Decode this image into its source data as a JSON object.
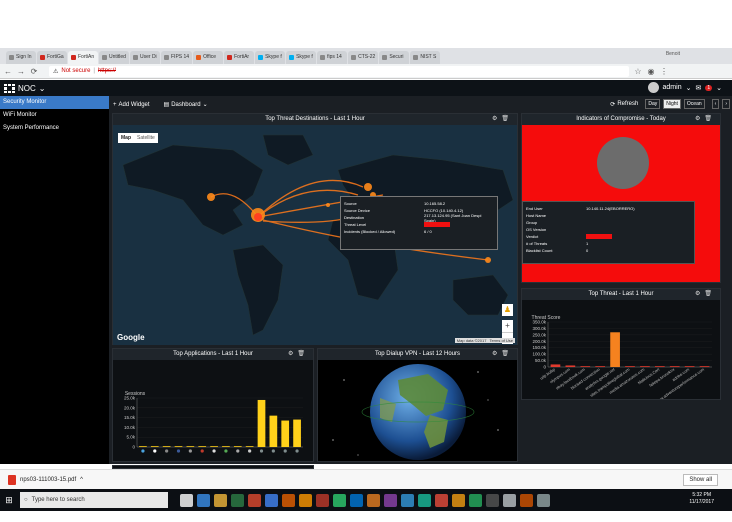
{
  "browser": {
    "tabs": [
      {
        "label": "Sign In",
        "icon": "page-icon"
      },
      {
        "label": "FortiGa",
        "icon": "fortinet-icon"
      },
      {
        "label": "FortiAn",
        "icon": "fortinet-icon",
        "active": true
      },
      {
        "label": "Untitled",
        "icon": "page-icon"
      },
      {
        "label": "User Di",
        "icon": "page-icon"
      },
      {
        "label": "FIPS 14",
        "icon": "page-icon"
      },
      {
        "label": "Office",
        "icon": "office-icon"
      },
      {
        "label": "FortiAr",
        "icon": "fortinet-icon"
      },
      {
        "label": "Skype f",
        "icon": "skype-icon"
      },
      {
        "label": "Skype f",
        "icon": "skype-icon"
      },
      {
        "label": "fips 14",
        "icon": "google-icon"
      },
      {
        "label": "CTS-22",
        "icon": "page-icon"
      },
      {
        "label": "Securi",
        "icon": "page-icon"
      },
      {
        "label": "NIST S",
        "icon": "page-icon"
      }
    ],
    "profile_name": "Benoit",
    "address": {
      "security": "Not secure",
      "url": "https://"
    }
  },
  "app": {
    "name": "NOC",
    "user": "admin",
    "notification_count": "1"
  },
  "sidebar": {
    "items": [
      {
        "label": "Security Monitor",
        "active": true
      },
      {
        "label": "WiFi Monitor"
      },
      {
        "label": "System Performance"
      }
    ]
  },
  "toolbar": {
    "add_widget": "Add Widget",
    "dashboard": "Dashboard",
    "refresh": "Refresh",
    "modes": [
      "Day",
      "Night",
      "Ocean"
    ],
    "selected_mode": "Night"
  },
  "panels": {
    "threat_map": {
      "title": "Top Threat Destinations - Last 1 Hour",
      "map_tabs": [
        "Map",
        "Satellite"
      ],
      "google": "Google",
      "map_data": "Map data ©2017",
      "terms": "Terms of Use",
      "tooltip": {
        "rows": [
          {
            "k": "Source",
            "v": "10.165.58.2"
          },
          {
            "k": "Source Device",
            "v": "HCCFO (10.140.4.12)"
          },
          {
            "k": "Destination",
            "v": "217.13.124.95 (Sant Joan Despi Spain)"
          },
          {
            "k": "Threat Level",
            "v": ""
          },
          {
            "k": "Incidents (Blocked / Allowed)",
            "v": "6 / 0"
          }
        ]
      }
    },
    "ioc": {
      "title": "Indicators of Compromise - Today",
      "rows": [
        {
          "k": "End User",
          "v": "10.140.11.24(EBORRERO)"
        },
        {
          "k": "Host Name",
          "v": ""
        },
        {
          "k": "Group",
          "v": ""
        },
        {
          "k": "OS Version",
          "v": ""
        },
        {
          "k": "Verdict",
          "v": ""
        },
        {
          "k": "# of Threats",
          "v": "1"
        },
        {
          "k": "Blacklist Count",
          "v": "0"
        }
      ]
    },
    "top_apps": {
      "title": "Top Applications - Last 1 Hour"
    },
    "top_vpn": {
      "title": "Top Dialup VPN - Last 12 Hours"
    },
    "top_threat": {
      "title": "Top Threat - Last 1 Hour"
    }
  },
  "chart_data": [
    {
      "type": "bar",
      "title": "Top Applications - Last 1 Hour",
      "ylabel": "Sessions",
      "yticks": [
        "0",
        "5.0k",
        "10.0k",
        "15.0k",
        "20.0k",
        "25.0k"
      ],
      "ylim": [
        0,
        25000
      ],
      "values": [
        100,
        100,
        100,
        100,
        100,
        100,
        100,
        100,
        100,
        100,
        24000,
        16000,
        13500,
        14000
      ],
      "colors": [
        "#ffd11a"
      ]
    },
    {
      "type": "bar",
      "title": "Top Threat - Last 1 Hour",
      "ylabel": "Threat Score",
      "yticks": [
        "0",
        "50.0k",
        "100.0k",
        "150.0k",
        "200.0k",
        "250.0k",
        "300.0k",
        "350.0k"
      ],
      "ylim": [
        0,
        350000
      ],
      "categories": [
        "udp.bulkp",
        "olympus.com",
        "ebay.facebook.com",
        "blocked-connection",
        "analytics.google.net",
        "sites.trampolineglobal.com",
        "media.amazonaws.com",
        "Malicious.Cert",
        "fakepa.brunoknx",
        "adobe.com",
        "www.adventureperformance.com"
      ],
      "values": [
        20000,
        12000,
        5000,
        2000,
        270000,
        5000,
        2000,
        1500,
        1000,
        800,
        500
      ],
      "colors": [
        "#e23b2e",
        "#e23b2e",
        "#e23b2e",
        "#e23b2e",
        "#f5821f",
        "#e23b2e",
        "#e23b2e",
        "#e23b2e",
        "#e23b2e",
        "#e23b2e",
        "#e23b2e"
      ]
    }
  ],
  "downloads": {
    "file": "nps03-111003-15.pdf",
    "show_all": "Show all"
  },
  "taskbar": {
    "search_placeholder": "Type here to search",
    "time": "5:32 PM",
    "date": "11/17/2017"
  }
}
